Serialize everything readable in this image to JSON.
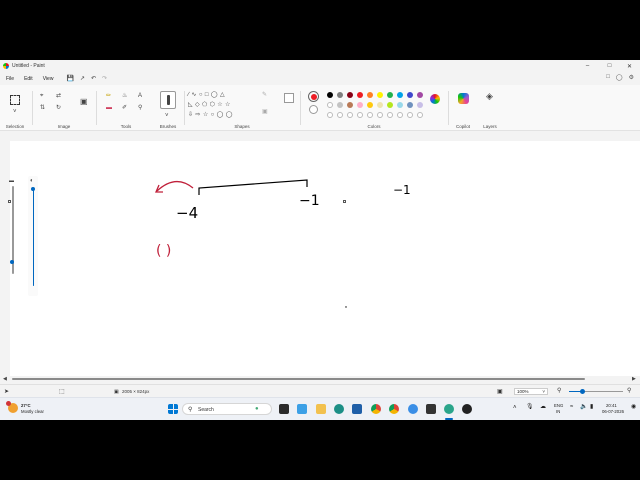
{
  "window": {
    "title": "Untitled - Paint"
  },
  "menu": {
    "file": "File",
    "edit": "Edit",
    "view": "View"
  },
  "ribbon": {
    "groups": {
      "selection": "Selection",
      "image": "Image",
      "tools": "Tools",
      "brushes": "Brushes",
      "shapes": "Shapes",
      "colors": "Colors",
      "copilot": "Copilot",
      "layers": "Layers"
    },
    "palette_row1": [
      "#000000",
      "#7f7f7f",
      "#880015",
      "#ed1c24",
      "#ff7f27",
      "#fff200",
      "#22b14c",
      "#00a2e8",
      "#3f48cc",
      "#a349a4"
    ],
    "palette_row2": [
      "#ffffff",
      "#c3c3c3",
      "#b97a57",
      "#ffaec9",
      "#ffc90e",
      "#efe4b0",
      "#b5e61d",
      "#99d9ea",
      "#7092be",
      "#c8bfe7"
    ],
    "active_color": "#ed1c24"
  },
  "canvas": {
    "strokes": {
      "stroke_color": "#000000",
      "arrow_color": "#c0203a",
      "labels": {
        "a": "−4",
        "b": "−1",
        "c": "−1",
        "d": "( )"
      }
    }
  },
  "status": {
    "canvas_size": "2005 × 824px",
    "zoom": "100%"
  },
  "taskbar": {
    "search_placeholder": "Search",
    "weather_temp": "27°C",
    "weather_desc": "Mostly clear",
    "lang_top": "ENG",
    "lang_bottom": "IN",
    "time": "20:41",
    "date": "06-07-2026"
  }
}
